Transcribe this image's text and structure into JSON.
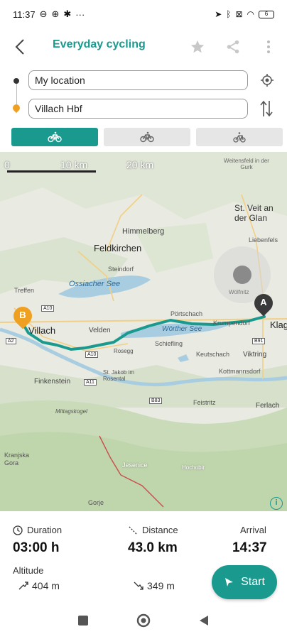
{
  "status_bar": {
    "time": "11:37",
    "notif_icons": [
      "dnd-icon",
      "wheel-icon",
      "settings-icon"
    ],
    "more": "···",
    "battery": "6"
  },
  "header": {
    "title": "Everyday cycling"
  },
  "route": {
    "start": "My location",
    "destination": "Villach Hbf"
  },
  "modes": [
    {
      "name": "everyday-bike",
      "active": true
    },
    {
      "name": "mountain-bike",
      "active": false
    },
    {
      "name": "road-bike",
      "active": false
    }
  ],
  "map": {
    "scale": [
      "0",
      "10 km",
      "20 km"
    ],
    "places": [
      "Feldkirchen",
      "St. Veit an der Glan",
      "Himmelberg",
      "Ossiacher See",
      "Steindorf",
      "Treffen",
      "Villach",
      "Velden",
      "Pörtschach",
      "Wörther See",
      "Krumpendorf",
      "Klagenfurt",
      "Schiefling",
      "Keutschach",
      "Viktring",
      "Rosegg",
      "St. Jakob im Rosental",
      "Finkenstein",
      "Kottmannsdorf",
      "Feistritz",
      "Ferlach",
      "Mittagskogel",
      "Kranjska Gora",
      "Jesenice",
      "Gorje",
      "Hochobir",
      "Liebenfels",
      "Weitensfeld in der Gurk",
      "Wölfnitz"
    ],
    "road_labels": [
      "A10",
      "A2",
      "A11",
      "A10",
      "B83",
      "B91"
    ],
    "marker_start": "A",
    "marker_end": "B",
    "route_color": "#1a9a8e"
  },
  "stats": {
    "duration_label": "Duration",
    "duration": "03:00 h",
    "distance_label": "Distance",
    "distance": "43.0 km",
    "arrival_label": "Arrival",
    "arrival": "14:37",
    "altitude_label": "Altitude",
    "ascent": "404 m",
    "descent": "349 m",
    "start_label": "Start"
  }
}
